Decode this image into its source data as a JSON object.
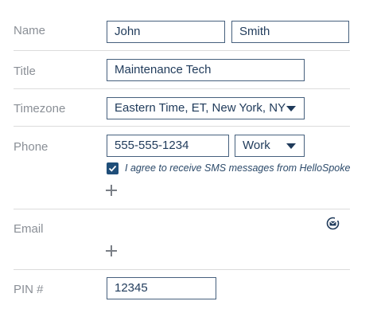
{
  "labels": {
    "name": "Name",
    "title": "Title",
    "timezone": "Timezone",
    "phone": "Phone",
    "email": "Email",
    "pin": "PIN #"
  },
  "fields": {
    "first_name": "John",
    "last_name": "Smith",
    "title": "Maintenance Tech",
    "timezone": "Eastern Time, ET, New York, NY",
    "phone": "555-555-1234",
    "phone_type": "Work",
    "pin": "12345"
  },
  "sms_consent": {
    "checked": true,
    "label": "I agree to receive SMS messages from HelloSpoke"
  },
  "icons": {
    "add_phone": "plus-icon",
    "add_email": "plus-icon",
    "email_action": "email-redirect-icon"
  },
  "colors": {
    "field_border": "#46607d",
    "text": "#1f3a5a",
    "label": "#8a8f96",
    "checkbox": "#1f4e79"
  }
}
